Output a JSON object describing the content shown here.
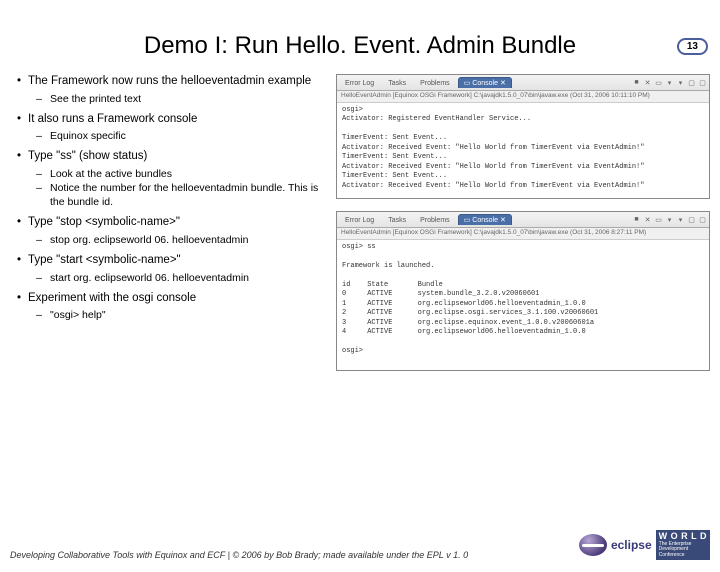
{
  "pageNumber": "13",
  "title": "Demo I: Run Hello. Event. Admin Bundle",
  "bullets": [
    {
      "text": "The Framework now runs the helloeventadmin example",
      "subs": [
        "See the printed text"
      ]
    },
    {
      "text": "It also runs a Framework console",
      "subs": [
        "Equinox specific"
      ]
    },
    {
      "text": "Type \"ss\" (show status)",
      "subs": [
        "Look at the active bundles",
        "Notice the number for the helloeventadmin bundle. This is the bundle id."
      ]
    },
    {
      "text": "Type \"stop <symbolic-name>\"",
      "subs": [
        "stop org. eclipseworld 06. helloeventadmin"
      ]
    },
    {
      "text": "Type \"start <symbolic-name>\"",
      "subs": [
        "start org. eclipseworld 06. helloeventadmin"
      ]
    },
    {
      "text": "Experiment with the osgi console",
      "subs": [
        "\"osgi> help\""
      ]
    }
  ],
  "consoles": [
    {
      "tabs": {
        "inactive": [
          "Error Log",
          "Tasks",
          "Problems"
        ],
        "active": "Console",
        "close": "✕"
      },
      "subbar": "HelloEventAdmin [Equinox OSGi Framework] C:\\javajdk1.5.0_07\\bin\\javaw.exe (Oct 31, 2006 10:11:10 PM)",
      "body": "osgi>\nActivator: Registered EventHandler Service...\n\nTimerEvent: Sent Event...\nActivator: Received Event: \"Hello World from TimerEvent via EventAdmin!\"\nTimerEvent: Sent Event...\nActivator: Received Event: \"Hello World from TimerEvent via EventAdmin!\"\nTimerEvent: Sent Event...\nActivator: Received Event: \"Hello World from TimerEvent via EventAdmin!\""
    },
    {
      "tabs": {
        "inactive": [
          "Error Log",
          "Tasks",
          "Problems"
        ],
        "active": "Console",
        "close": "✕"
      },
      "subbar": "HelloEventAdmin [Equinox OSGi Framework] C:\\javajdk1.5.0_07\\bin\\javaw.exe (Oct 31, 2006 8:27:11 PM)",
      "body": "osgi> ss\n\nFramework is launched.\n\nid    State       Bundle\n0     ACTIVE      system.bundle_3.2.0.v20060601\n1     ACTIVE      org.eclipseworld06.helloeventadmin_1.0.0\n2     ACTIVE      org.eclipse.osgi.services_3.1.100.v20060601\n3     ACTIVE      org.eclipse.equinox.event_1.0.0.v20060601a\n4     ACTIVE      org.eclipseworld06.helloeventadmin_1.0.0\n\nosgi>"
    }
  ],
  "footer": "Developing Collaborative Tools with Equinox and ECF | © 2006 by Bob Brady; made available under the EPL v 1. 0",
  "logo": {
    "eclipse": "eclipse",
    "world": "W O R L D",
    "tagline1": "The Enterprise",
    "tagline2": "Development",
    "tagline3": "Conference"
  },
  "icons": {
    "doc": "▭",
    "x": "✕",
    "min": "▢",
    "drop": "▾",
    "stop": "■"
  }
}
